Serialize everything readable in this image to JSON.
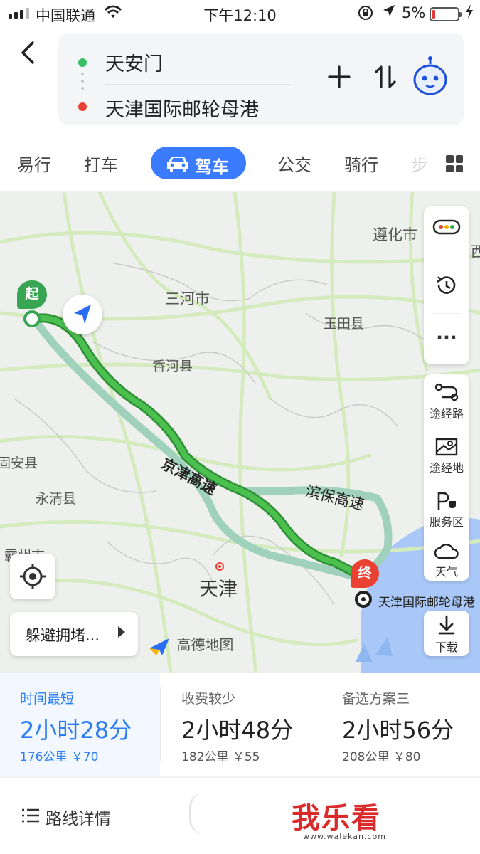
{
  "status_bar": {
    "carrier": "中国联通",
    "time": "下午12:10",
    "battery_percent": "5%",
    "battery_level": 0.05,
    "icons": [
      "signal-icon",
      "wifi-icon",
      "orientation-lock-icon",
      "location-arrow-icon",
      "battery-icon",
      "charging-icon"
    ]
  },
  "route": {
    "from": "天安门",
    "to": "天津国际邮轮母港"
  },
  "tabs": [
    {
      "label": "易行"
    },
    {
      "label": "打车"
    },
    {
      "label": "驾车",
      "active": true
    },
    {
      "label": "公交"
    },
    {
      "label": "骑行"
    },
    {
      "label": "步"
    }
  ],
  "map": {
    "labels": {
      "zunhua": "遵化市",
      "xi": "西",
      "sanhe": "三河市",
      "yutian": "玉田县",
      "xianghe": "香河县",
      "guan": "固安县",
      "yongqing": "永清县",
      "bazhou": "霸州市",
      "tianjin": "天津",
      "jingjin": "京津高速",
      "binbao": "滨保高速",
      "dest": "天津国际邮轮母港"
    },
    "start_badge": "起",
    "end_badge": "终",
    "colors": {
      "main_route": "#3bab3f",
      "alt_route": "#9fd1bd",
      "water": "#a9c8f7",
      "road": "#cfe8b4"
    }
  },
  "controls": {
    "traffic_label": "",
    "history_label": "",
    "more_label": "···",
    "waypoint_route": "途经路",
    "waypoint_place": "途经地",
    "service_area": "服务区",
    "weather": "天气",
    "download": "下载"
  },
  "avoid_label": "躲避拥堵...",
  "map_logo": "高德地图",
  "plans": [
    {
      "label": "时间最短",
      "duration": "2小时28分",
      "meta": "176公里 ￥70",
      "selected": true
    },
    {
      "label": "收费较少",
      "duration": "2小时48分",
      "meta": "182公里 ￥55"
    },
    {
      "label": "备选方案三",
      "duration": "2小时56分",
      "meta": "208公里 ￥80"
    }
  ],
  "bottom": {
    "detail_label": "路线详情",
    "watermark": "我乐看",
    "watermark_url": "www.walekan.com"
  }
}
